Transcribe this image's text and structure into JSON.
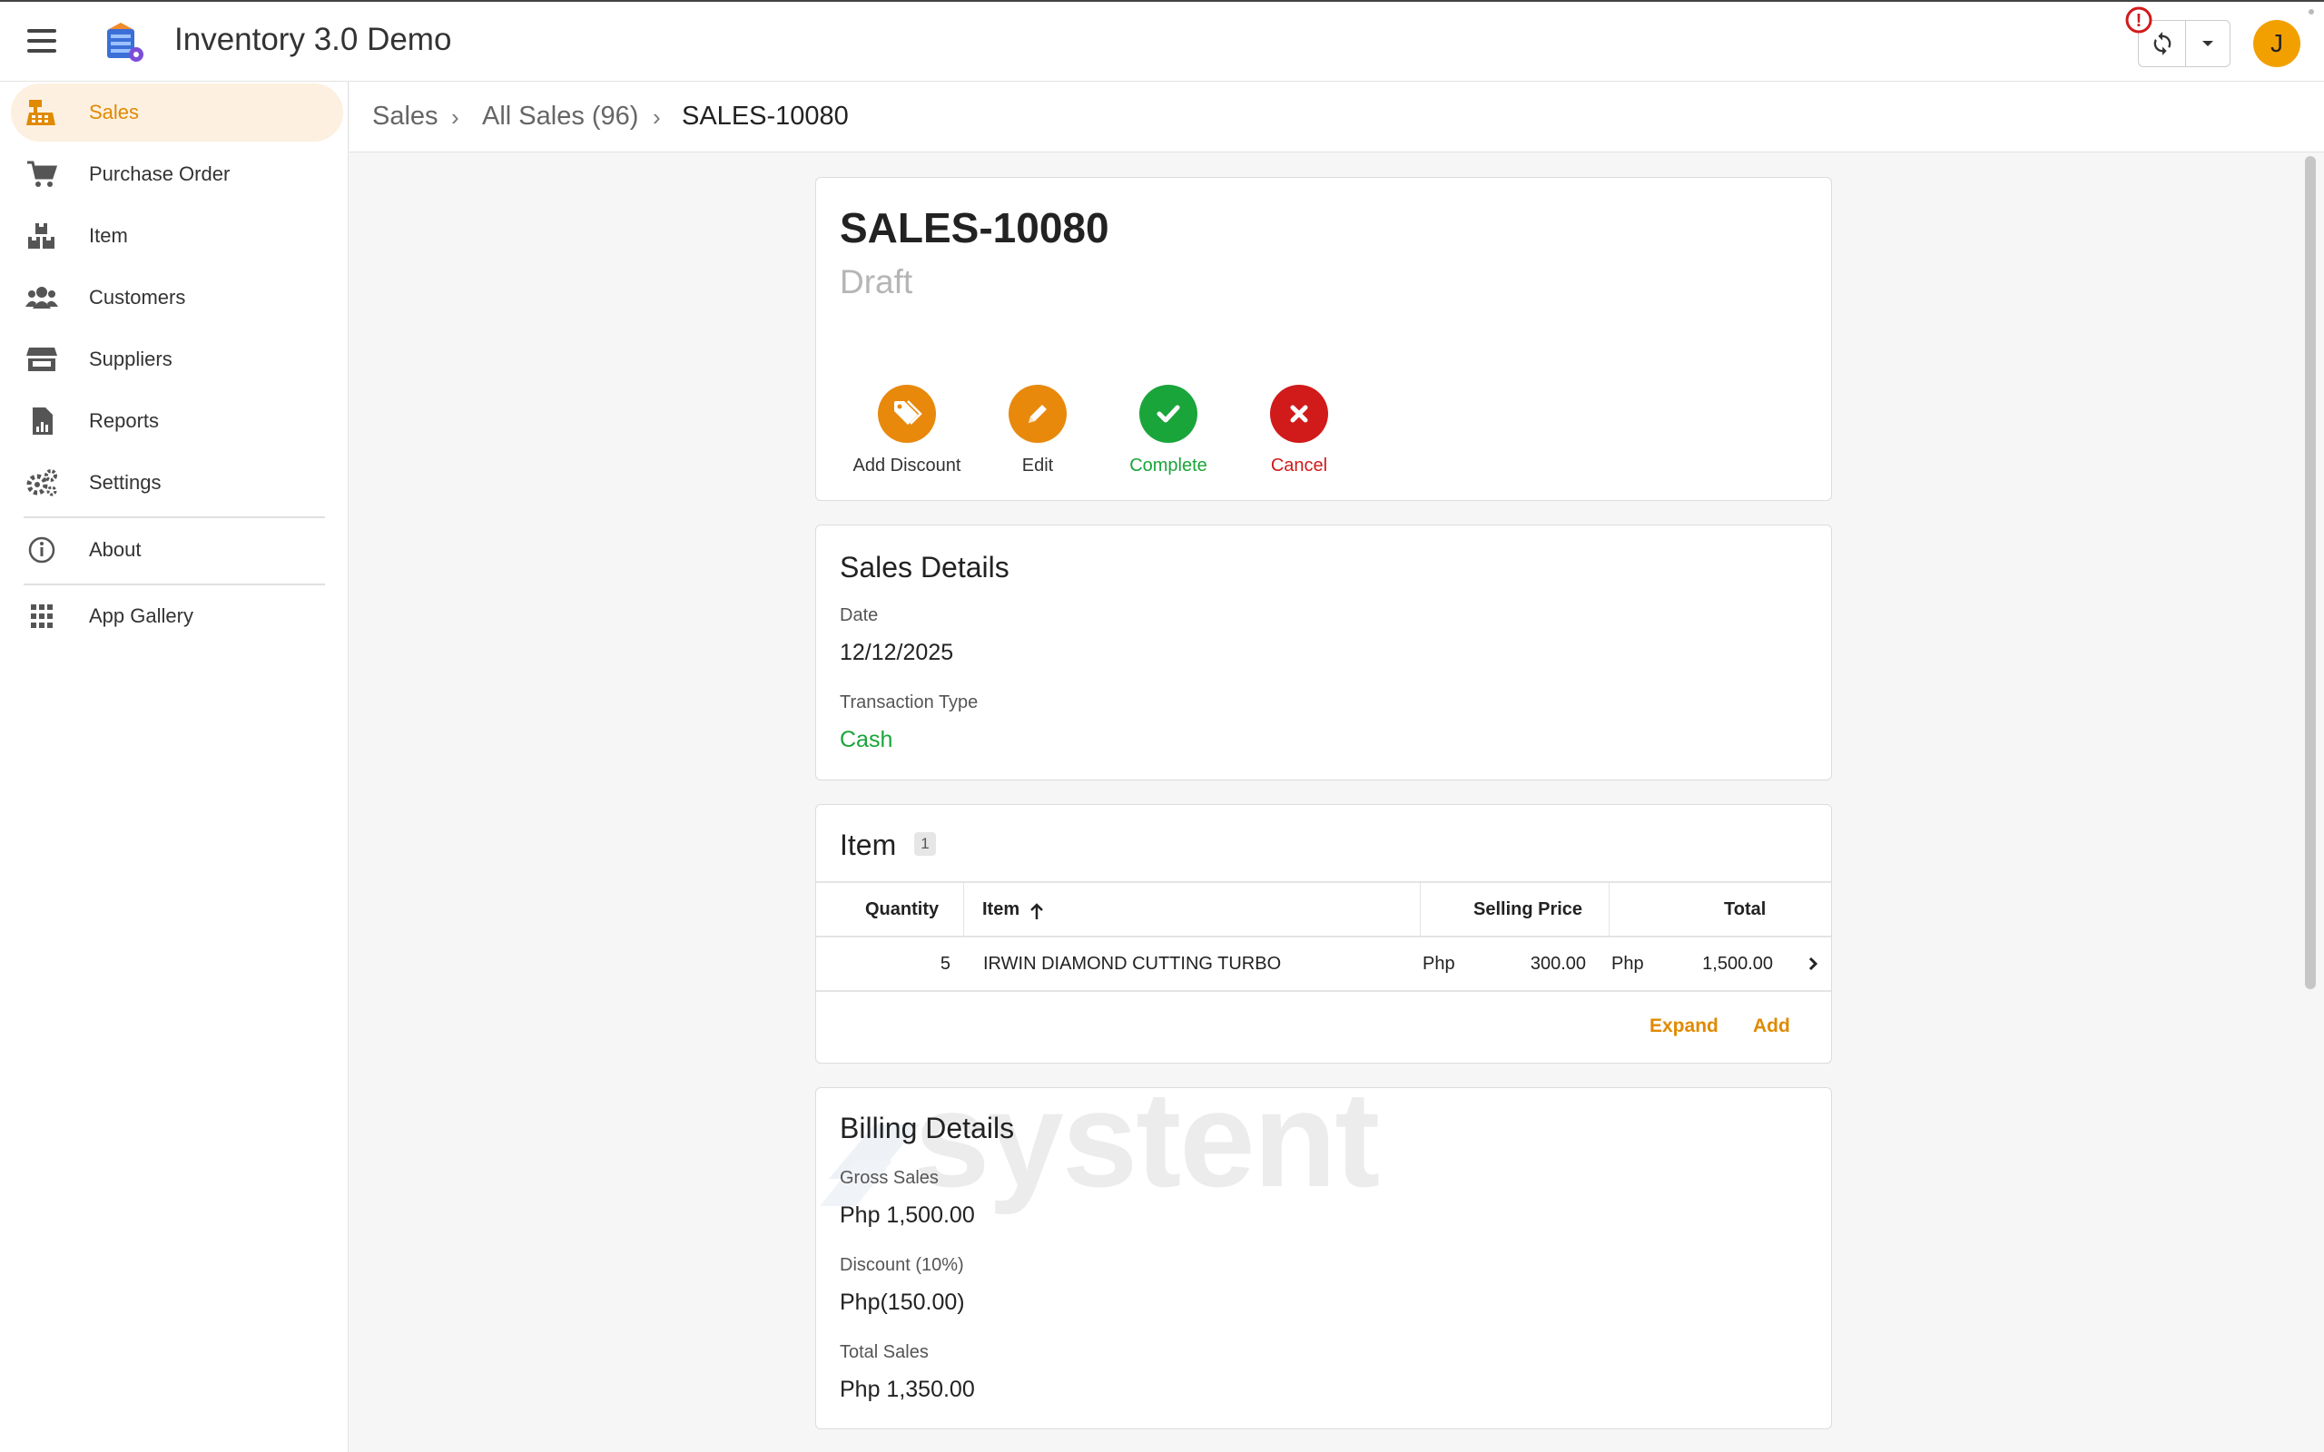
{
  "header": {
    "title": "Inventory 3.0 Demo",
    "avatar_initial": "J",
    "warning_symbol": "!"
  },
  "sidebar": {
    "items": [
      {
        "label": "Sales",
        "icon": "cash-register-icon",
        "active": true
      },
      {
        "label": "Purchase Order",
        "icon": "cart-icon"
      },
      {
        "label": "Item",
        "icon": "boxes-icon"
      },
      {
        "label": "Customers",
        "icon": "users-icon"
      },
      {
        "label": "Suppliers",
        "icon": "store-icon"
      },
      {
        "label": "Reports",
        "icon": "report-file-icon"
      },
      {
        "label": "Settings",
        "icon": "gears-icon"
      },
      {
        "label": "About",
        "icon": "info-icon"
      },
      {
        "label": "App Gallery",
        "icon": "grid-icon"
      }
    ]
  },
  "breadcrumb": {
    "root": "Sales",
    "list": "All Sales (96)",
    "current": "SALES-10080",
    "separator": "›"
  },
  "document": {
    "id": "SALES-10080",
    "status": "Draft",
    "actions": [
      {
        "label": "Add Discount",
        "icon": "tag-icon",
        "color": "#e8890c"
      },
      {
        "label": "Edit",
        "icon": "pencil-icon",
        "color": "#e8890c"
      },
      {
        "label": "Complete",
        "icon": "check-icon",
        "color": "#1aa53a"
      },
      {
        "label": "Cancel",
        "icon": "close-icon",
        "color": "#d11a1a"
      }
    ]
  },
  "sales_details": {
    "title": "Sales Details",
    "date_label": "Date",
    "date_value": "12/12/2025",
    "type_label": "Transaction Type",
    "type_value": "Cash",
    "type_color": "#1aa53a"
  },
  "items": {
    "title": "Item",
    "count": "1",
    "columns": {
      "quantity": "Quantity",
      "item": "Item",
      "price": "Selling Price",
      "total": "Total"
    },
    "rows": [
      {
        "quantity": "5",
        "item": "IRWIN DIAMOND CUTTING TURBO",
        "price_currency": "Php",
        "price": "300.00",
        "total_currency": "Php",
        "total": "1,500.00"
      }
    ],
    "expand_label": "Expand",
    "add_label": "Add"
  },
  "billing": {
    "title": "Billing Details",
    "gross_label": "Gross Sales",
    "gross_value": "Php 1,500.00",
    "discount_label": "Discount (10%)",
    "discount_value": "Php(150.00)",
    "total_label": "Total Sales",
    "total_value": "Php 1,350.00",
    "watermark": "systent"
  },
  "colors": {
    "accent": "#e8890c",
    "success": "#1aa53a",
    "danger": "#d11a1a"
  }
}
